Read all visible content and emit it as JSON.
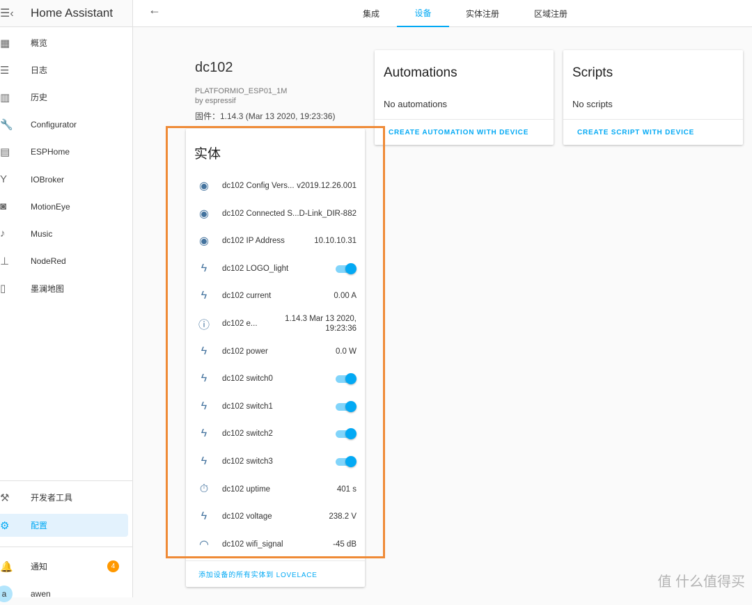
{
  "app": {
    "title": "Home Assistant",
    "menu_icon": "menu-open-icon"
  },
  "sidebar": {
    "items": [
      {
        "label": "概览",
        "icon": "apps-icon",
        "glyph": "▦"
      },
      {
        "label": "日志",
        "icon": "list-icon",
        "glyph": "☰"
      },
      {
        "label": "历史",
        "icon": "chart-bar-icon",
        "glyph": "▥"
      },
      {
        "label": "Configurator",
        "icon": "wrench-icon",
        "glyph": "🔧"
      },
      {
        "label": "ESPHome",
        "icon": "chip-icon",
        "glyph": "▤"
      },
      {
        "label": "IOBroker",
        "icon": "fork-icon",
        "glyph": "Y"
      },
      {
        "label": "MotionEye",
        "icon": "camera-icon",
        "glyph": "◙"
      },
      {
        "label": "Music",
        "icon": "music-box-icon",
        "glyph": "♪"
      },
      {
        "label": "NodeRed",
        "icon": "sitemap-icon",
        "glyph": "⊥"
      },
      {
        "label": "墨澜地图",
        "icon": "map-icon",
        "glyph": "▯"
      }
    ],
    "bottom": [
      {
        "label": "开发者工具",
        "icon": "hammer-icon",
        "glyph": "⚒"
      },
      {
        "label": "配置",
        "icon": "gear-icon",
        "glyph": "⚙"
      }
    ],
    "notifications": {
      "label": "通知",
      "count": "4",
      "glyph": "🔔"
    },
    "user": {
      "name": "awen",
      "initial": "a"
    }
  },
  "header": {
    "tabs": [
      "集成",
      "设备",
      "实体注册",
      "区域注册"
    ],
    "active_tab": "设备",
    "back_glyph": "←"
  },
  "device": {
    "name": "dc102",
    "model": "PLATFORMIO_ESP01_1M",
    "manufacturer": "by espressif",
    "firmware": "固件：1.14.3 (Mar 13 2020, 19:23:36)"
  },
  "entities": {
    "title": "实体",
    "action": "添加设备的所有实体到 LOVELACE",
    "rows": [
      {
        "name": "dc102 Config Vers...",
        "value": "v2019.12.26.001",
        "icon": "eye-icon"
      },
      {
        "name": "dc102 Connected S...",
        "value": "D-Link_DIR-882",
        "icon": "eye-icon"
      },
      {
        "name": "dc102 IP Address",
        "value": "10.10.10.31",
        "icon": "eye-icon"
      },
      {
        "name": "dc102 LOGO_light",
        "toggle": true,
        "icon": "flash-icon"
      },
      {
        "name": "dc102 current",
        "value": "0.00 A",
        "icon": "flash-icon"
      },
      {
        "name": "dc102 e...",
        "value": "1.14.3 Mar 13 2020,",
        "value2": "19:23:36",
        "icon": "info-icon"
      },
      {
        "name": "dc102 power",
        "value": "0.0 W",
        "icon": "flash-icon"
      },
      {
        "name": "dc102 switch0",
        "toggle": true,
        "icon": "flash-icon"
      },
      {
        "name": "dc102 switch1",
        "toggle": true,
        "icon": "flash-icon"
      },
      {
        "name": "dc102 switch2",
        "toggle": true,
        "icon": "flash-icon"
      },
      {
        "name": "dc102 switch3",
        "toggle": true,
        "icon": "flash-icon"
      },
      {
        "name": "dc102 uptime",
        "value": "401 s",
        "icon": "timer-icon"
      },
      {
        "name": "dc102 voltage",
        "value": "238.2 V",
        "icon": "flash-icon"
      },
      {
        "name": "dc102 wifi_signal",
        "value": "-45 dB",
        "icon": "wifi-icon"
      }
    ]
  },
  "automations": {
    "title": "Automations",
    "empty": "No automations",
    "action": "CREATE AUTOMATION WITH DEVICE"
  },
  "scripts": {
    "title": "Scripts",
    "empty": "No scripts",
    "action": "CREATE SCRIPT WITH DEVICE"
  },
  "colors": {
    "accent": "#03a9f4",
    "icon": "#44739e",
    "highlight": "#ef8a36",
    "badge": "#ff9800"
  },
  "watermark": "值 什么值得买"
}
